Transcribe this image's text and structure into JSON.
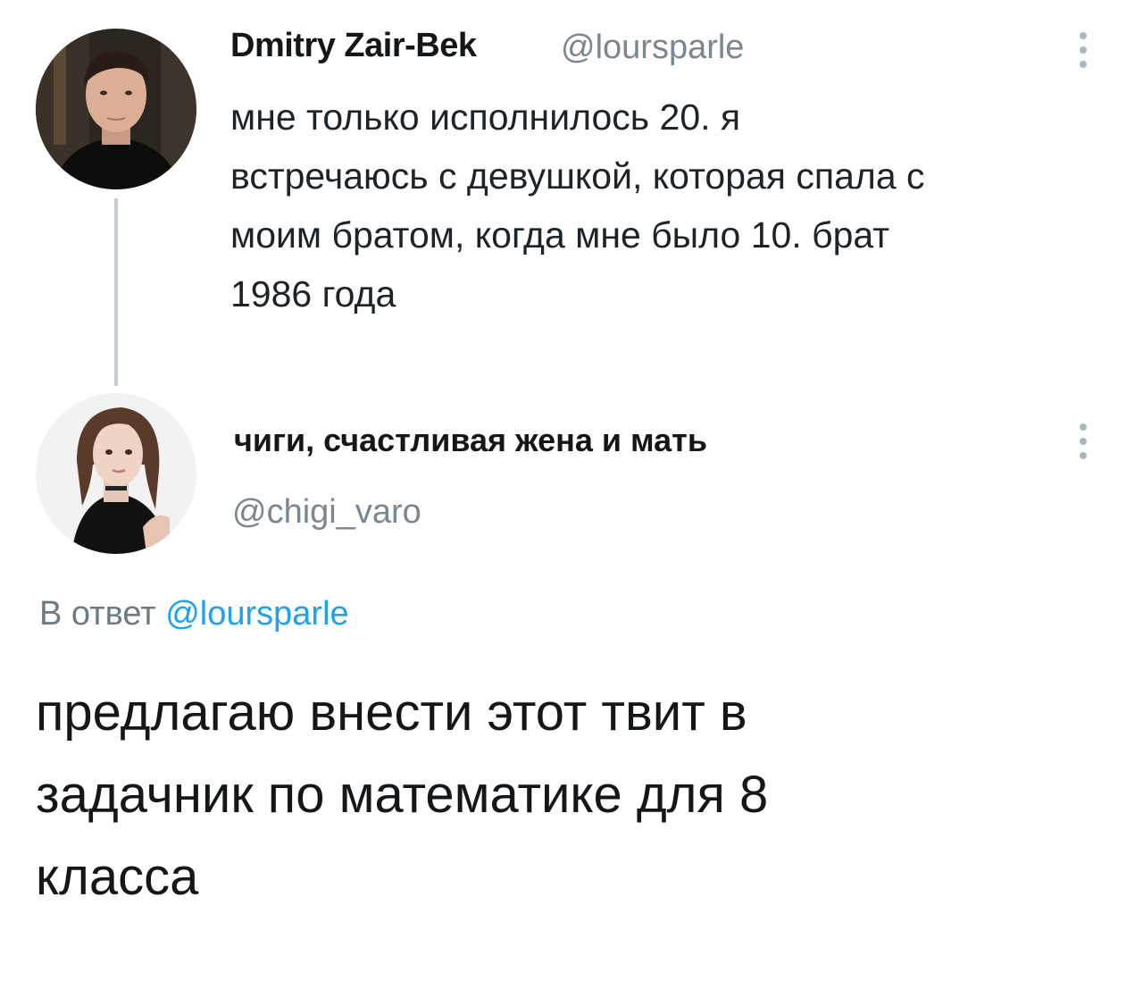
{
  "tweet": {
    "author_name": "Dmitry Zair-Bek",
    "author_handle": "@loursparle",
    "text_lines": [
      "мне только исполнилось 20. я",
      "встречаюсь с девушкой, которая спала с",
      "моим братом, когда мне было 10. брат",
      "1986 года"
    ],
    "avatar_icon": "person-photo-avatar",
    "menu_icon": "more-vertical-icon"
  },
  "reply": {
    "author_name": "чиги, счастливая жена и мать",
    "author_handle": "@chigi_varo",
    "reply_prefix": "В ответ",
    "reply_mention": "@loursparle",
    "text_lines": [
      "предлагаю внести этот твит в",
      "задачник по математике для 8",
      "класса"
    ],
    "avatar_icon": "person-photo-avatar",
    "menu_icon": "more-vertical-icon"
  },
  "colors": {
    "text": "#14171a",
    "secondary": "#7a8791",
    "link": "#1da1f2",
    "thread_line": "#c8d0d6"
  }
}
